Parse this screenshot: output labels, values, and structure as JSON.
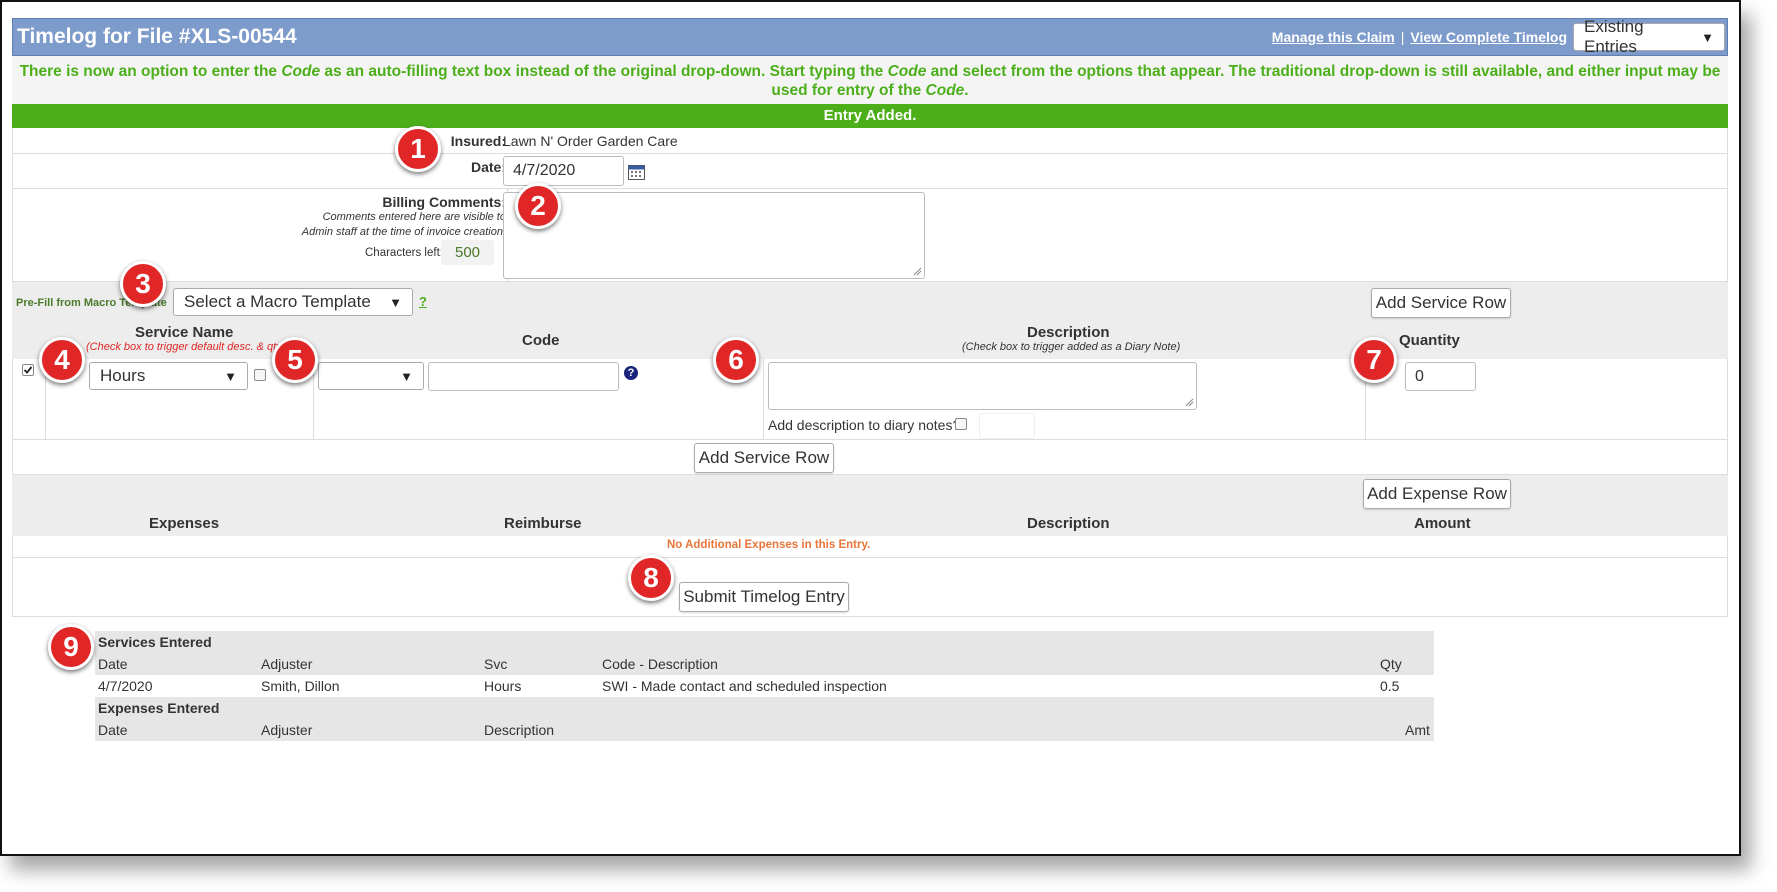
{
  "header": {
    "title": "Timelog for File #XLS-00544",
    "manage_link": "Manage this Claim",
    "separator": "|",
    "timelog_link": "View Complete Timelog",
    "entries_select": "Existing Entries"
  },
  "notice": {
    "part1": "There is now an option to enter the ",
    "code_word": "Code",
    "part2": " as an auto-filling text box instead of the original drop-down. Start typing the ",
    "part3": " and select from the options that appear. The traditional drop-down is still available, and either input may be used for entry of the ",
    "part4": "."
  },
  "status": "Entry Added.",
  "form": {
    "insured_label": "Insured:",
    "insured_value": "Lawn N' Order Garden Care",
    "date_label": "Date:",
    "date_value": "4/7/2020",
    "billing_label": "Billing Comments:",
    "billing_note1": "Comments entered here are visible to",
    "billing_note2": "Admin staff at the time of invoice creation.",
    "chars_left_label": "Characters left:",
    "chars_left_value": "500"
  },
  "macro": {
    "label": "Pre-Fill from Macro Template",
    "select": "Select a Macro Template",
    "help": "?",
    "add_service_top": "Add Service Row"
  },
  "service_header": {
    "service_name": "Service Name",
    "service_note": "(Check box to trigger default desc. & qty)",
    "code": "Code",
    "description": "Description",
    "description_note": "(Check box to trigger added as a Diary Note)",
    "quantity": "Quantity"
  },
  "service_row": {
    "service_select": "Hours",
    "code_select": "",
    "code_text": "",
    "description": "",
    "diary_label": "Add description to diary notes?",
    "quantity": "0"
  },
  "add_service_bottom": "Add Service Row",
  "expenses": {
    "add_expense": "Add Expense Row",
    "col_expenses": "Expenses",
    "col_reimburse": "Reimburse",
    "col_description": "Description",
    "col_amount": "Amount",
    "empty": "No Additional Expenses in this Entry."
  },
  "submit": "Submit Timelog Entry",
  "summary": {
    "services_title": "Services Entered",
    "svc_cols": [
      "Date",
      "Adjuster",
      "Svc",
      "Code - Description",
      "Qty"
    ],
    "svc_row": [
      "4/7/2020",
      "Smith, Dillon",
      "Hours",
      "SWI - Made contact and scheduled inspection",
      "0.5"
    ],
    "expenses_title": "Expenses Entered",
    "exp_cols": [
      "Date",
      "Adjuster",
      "Description",
      "Amt"
    ]
  },
  "badges": [
    "1",
    "2",
    "3",
    "4",
    "5",
    "6",
    "7",
    "8",
    "9"
  ],
  "colors": {
    "title_bar": "#7d9bcb",
    "notice_green": "#4caf1a",
    "badge_red": "#e02626",
    "empty_orange": "#e8753a"
  }
}
